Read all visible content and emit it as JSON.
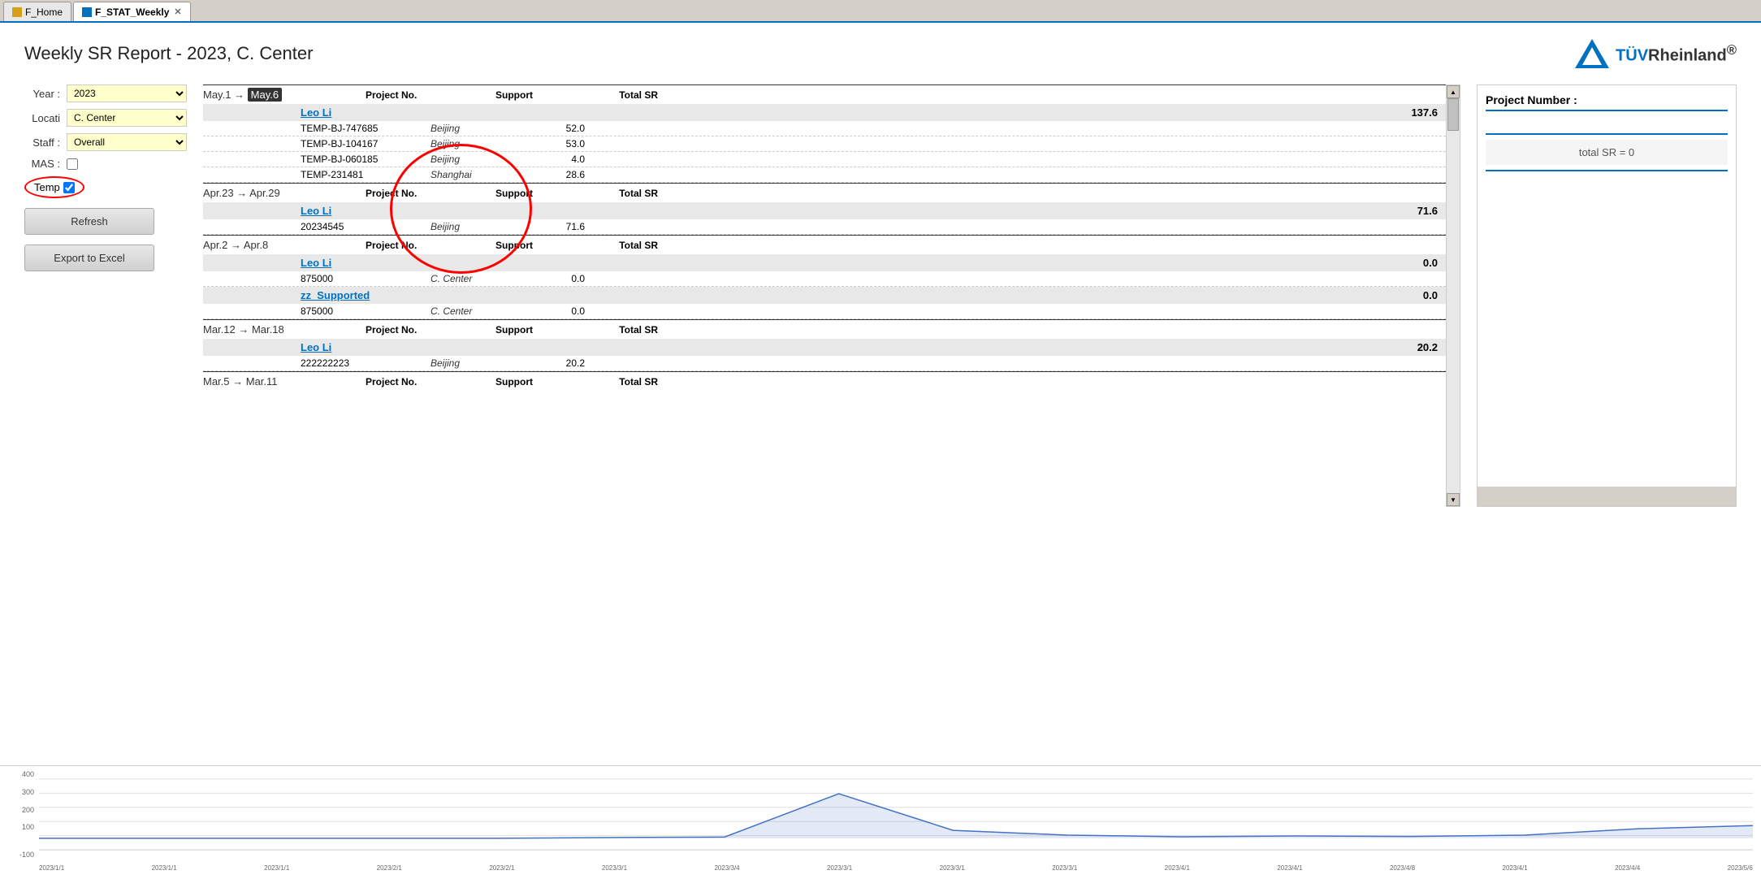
{
  "tabs": [
    {
      "id": "f-home",
      "label": "F_Home",
      "icon": "home",
      "active": false
    },
    {
      "id": "f-stat-weekly",
      "label": "F_STAT_Weekly",
      "icon": "chart",
      "active": true
    }
  ],
  "header": {
    "title": "Weekly SR Report - 2023, C. Center",
    "logo_text": "TÜVRheinland®"
  },
  "controls": {
    "year_label": "Year :",
    "year_value": "2023",
    "location_label": "Locati",
    "location_value": "C. Center",
    "staff_label": "Staff :",
    "staff_value": "Overall",
    "mas_label": "MAS :",
    "mas_checked": false,
    "temp_label": "Temp",
    "temp_checked": true,
    "refresh_label": "Refresh",
    "export_label": "Export to Excel"
  },
  "weeks": [
    {
      "range": "May.1 → May.6",
      "range_start": "May.1",
      "range_arrow": "→",
      "range_end": "May.6",
      "range_end_highlighted": true,
      "col_project": "Project No.",
      "col_support": "Support",
      "col_total": "Total SR",
      "persons": [
        {
          "name": "Leo Li",
          "total": "137.6",
          "rows": [
            {
              "project": "TEMP-BJ-747685",
              "support": "Beijing",
              "total": "52.0"
            },
            {
              "project": "TEMP-BJ-104167",
              "support": "Beijing",
              "total": "53.0"
            },
            {
              "project": "TEMP-BJ-060185",
              "support": "Beijing",
              "total": "4.0"
            },
            {
              "project": "TEMP-231481",
              "support": "Shanghai",
              "total": "28.6"
            }
          ]
        }
      ]
    },
    {
      "range": "Apr.23 → Apr.29",
      "range_start": "Apr.23",
      "range_arrow": "→",
      "range_end": "Apr.29",
      "range_end_highlighted": false,
      "col_project": "Project No.",
      "col_support": "Support",
      "col_total": "Total SR",
      "persons": [
        {
          "name": "Leo Li",
          "total": "71.6",
          "rows": [
            {
              "project": "20234545",
              "support": "Beijing",
              "total": "71.6"
            }
          ]
        }
      ]
    },
    {
      "range": "Apr.2 → Apr.8",
      "range_start": "Apr.2",
      "range_arrow": "→",
      "range_end": "Apr.8",
      "range_end_highlighted": false,
      "col_project": "Project No.",
      "col_support": "Support",
      "col_total": "Total SR",
      "persons": [
        {
          "name": "Leo Li",
          "total": "0.0",
          "rows": [
            {
              "project": "875000",
              "support": "C. Center",
              "total": "0.0"
            }
          ]
        },
        {
          "name": "zz_Supported",
          "total": "0.0",
          "rows": [
            {
              "project": "875000",
              "support": "C. Center",
              "total": "0.0"
            }
          ]
        }
      ]
    },
    {
      "range": "Mar.12 → Mar.18",
      "range_start": "Mar.12",
      "range_arrow": "→",
      "range_end": "Mar.18",
      "range_end_highlighted": false,
      "col_project": "Project No.",
      "col_support": "Support",
      "col_total": "Total SR",
      "persons": [
        {
          "name": "Leo Li",
          "total": "20.2",
          "rows": [
            {
              "project": "222222223",
              "support": "Beijing",
              "total": "20.2"
            }
          ]
        }
      ]
    },
    {
      "range": "Mar.5 → Mar.11",
      "range_start": "Mar.5",
      "range_arrow": "→",
      "range_end": "Mar.11",
      "range_end_highlighted": false,
      "col_project": "Project No.",
      "col_support": "Support",
      "col_total": "Total SR",
      "persons": []
    }
  ],
  "right_panel": {
    "title": "Project Number :",
    "input_placeholder": "",
    "total_sr_label": "total SR = 0"
  },
  "chart": {
    "y_labels": [
      "400",
      "300",
      "200",
      "100",
      "",
      "-100"
    ],
    "x_labels": [
      "2023/1/1",
      "2023/1/1",
      "2023/1/1",
      "2023/2/1",
      "2023/2/1",
      "2023/3/1",
      "2023/3/4",
      "2023/3/1",
      "2023/3/1",
      "2023/3/1",
      "2023/4/1",
      "2023/4/1",
      "2023/4/8",
      "2023/4/1",
      "2023/4/4",
      "2023/5/6"
    ],
    "line_data": [
      0,
      0,
      0,
      0,
      0,
      5,
      8,
      280,
      50,
      20,
      10,
      15,
      12,
      20,
      60,
      80
    ]
  }
}
